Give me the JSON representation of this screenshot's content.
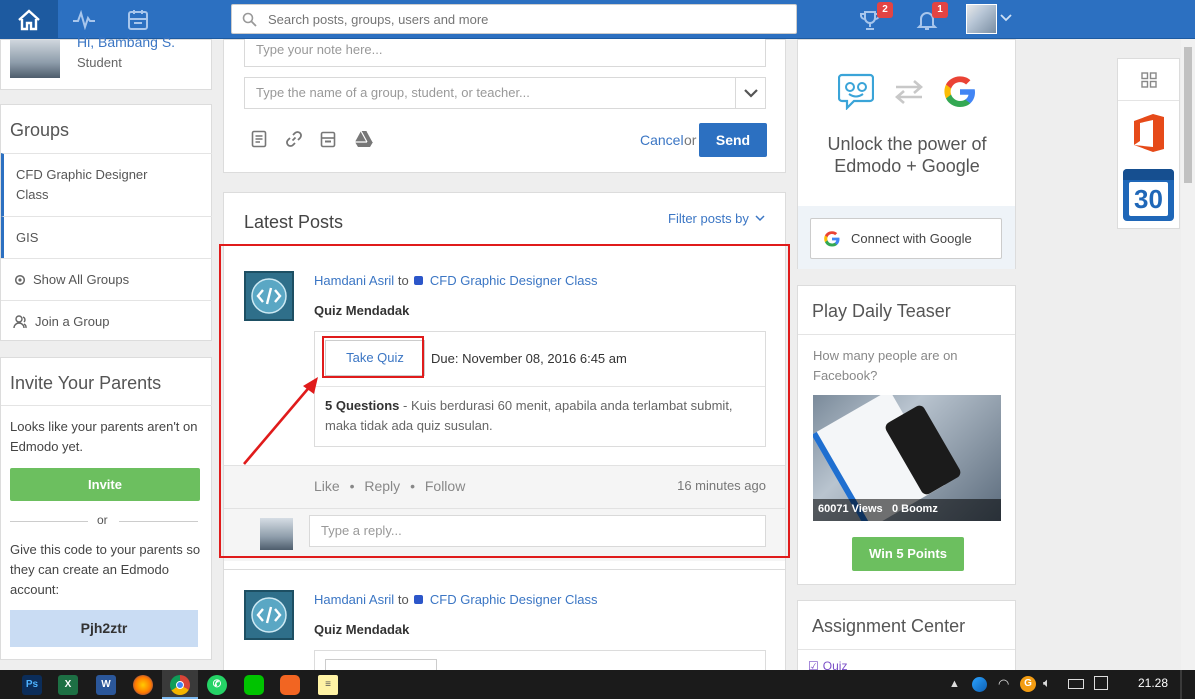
{
  "topbar": {
    "search_placeholder": "Search posts, groups, users and more",
    "trophy_badge": "2",
    "bell_badge": "1"
  },
  "profile": {
    "greeting": "Hi, Bambang S.",
    "role": "Student"
  },
  "groups": {
    "title": "Groups",
    "items": [
      "CFD Graphic Designer Class",
      "GIS"
    ],
    "show_all": "Show All Groups",
    "join": "Join a Group"
  },
  "invite": {
    "title": "Invite Your Parents",
    "text": "Looks like your parents aren't on Edmodo yet.",
    "button": "Invite",
    "or": "or",
    "code_text": "Give this code to your parents so they can create an Edmodo account:",
    "code": "Pjh2ztr"
  },
  "composer": {
    "note_placeholder": "Type your note here...",
    "to_placeholder": "Type the name of a group, student, or teacher...",
    "cancel": "Cancel",
    "or": "or",
    "send": "Send"
  },
  "feed": {
    "title": "Latest Posts",
    "filter": "Filter posts by",
    "posts": [
      {
        "author": "Hamdani Asril",
        "to": "to",
        "group": "CFD Graphic Designer Class",
        "title": "Quiz Mendadak",
        "take_quiz": "Take Quiz",
        "due": "Due: November 08, 2016 6:45 am",
        "questions": "5 Questions",
        "desc": " - Kuis berdurasi 60 menit, apabila anda terlambat submit, maka tidak ada quiz susulan.",
        "like": "Like",
        "reply": "Reply",
        "follow": "Follow",
        "time": "16 minutes ago",
        "reply_placeholder": "Type a reply..."
      },
      {
        "author": "Hamdani Asril",
        "to": "to",
        "group": "CFD Graphic Designer Class",
        "title": "Quiz Mendadak"
      }
    ]
  },
  "google": {
    "headline": "Unlock the power of Edmodo + Google",
    "connect": "Connect with Google"
  },
  "teaser": {
    "title": "Play Daily Teaser",
    "question": "How many people are on Facebook?",
    "views": "60071 Views",
    "boomz": "0 Boomz",
    "button": "Win 5 Points"
  },
  "assignment": {
    "title": "Assignment Center",
    "item": "Quiz"
  },
  "apps": {
    "calendar_day": "30"
  },
  "taskbar": {
    "clock": "21.28"
  },
  "colors": {
    "brand": "#2c70c1",
    "green": "#6cbf5f",
    "annotation": "#e01b1b"
  }
}
